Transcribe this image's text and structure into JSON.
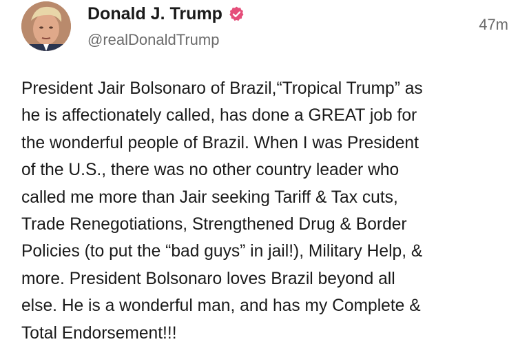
{
  "author": {
    "name": "Donald J. Trump",
    "handle": "@realDonaldTrump",
    "avatar_icon": "profile-photo",
    "verified_icon": "verified-badge-icon",
    "verified_color": "#e54e7a"
  },
  "timestamp": "47m",
  "post_lines": [
    "President Jair Bolsonaro of Brazil,“Tropical Trump” as",
    "he is affectionately called, has done a GREAT job for",
    "the wonderful people of Brazil. When I was President",
    "of the U.S., there was no other country leader who",
    "called me more than Jair seeking Tariff & Tax cuts,",
    "Trade Renegotiations, Strengthened Drug & Border",
    "Policies (to put the “bad guys” in jail!), Military Help, &",
    "more. President Bolsonaro loves Brazil beyond all",
    "else. He is a wonderful man, and has my Complete &",
    "Total Endorsement!!!"
  ]
}
